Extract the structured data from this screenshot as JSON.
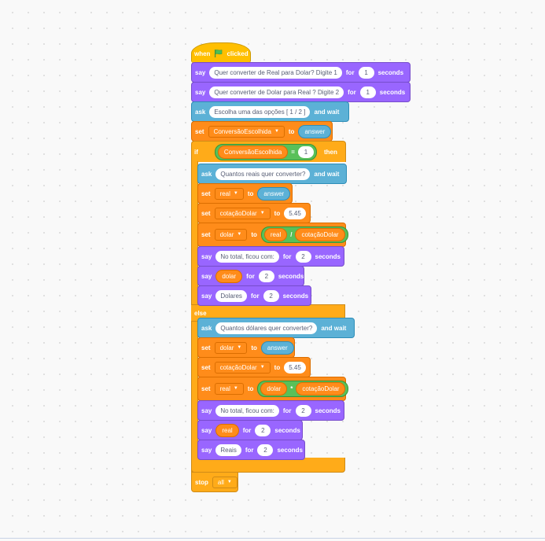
{
  "script": {
    "hat": {
      "when": "when",
      "clicked": "clicked",
      "flag_icon": "green-flag-icon"
    },
    "say1": {
      "kw": "say",
      "msg": "Quer converter de Real para Dolar? Digite 1",
      "for": "for",
      "secs": "1",
      "seconds": "seconds"
    },
    "say2": {
      "kw": "say",
      "msg": "Quer converter de Dolar para Real ? Digite 2",
      "for": "for",
      "secs": "1",
      "seconds": "seconds"
    },
    "ask1": {
      "kw": "ask",
      "question": "Escolha uma das opções [ 1 /  2 ]",
      "and_wait": "and wait"
    },
    "set1": {
      "kw": "set",
      "var": "ConversãoEscolhida",
      "to": "to",
      "value": "answer"
    },
    "if": {
      "kw": "if",
      "var": "ConversãoEscolhida",
      "op": "=",
      "value": "1",
      "then": "then",
      "else": "else"
    },
    "if_branch": {
      "ask": {
        "kw": "ask",
        "question": "Quantos reais quer converter?",
        "and_wait": "and wait"
      },
      "set_a": {
        "kw": "set",
        "var": "real",
        "to": "to",
        "value": "answer"
      },
      "set_b": {
        "kw": "set",
        "var": "cotaçãoDolar",
        "to": "to",
        "value": "5.45"
      },
      "set_c": {
        "kw": "set",
        "var": "dolar",
        "to": "to",
        "left": "real",
        "op": "/",
        "right": "cotaçãoDolar"
      },
      "say_a": {
        "kw": "say",
        "msg": "No total, ficou com:",
        "for": "for",
        "secs": "2",
        "seconds": "seconds"
      },
      "say_b": {
        "kw": "say",
        "msg": "dolar",
        "for": "for",
        "secs": "2",
        "seconds": "seconds"
      },
      "say_c": {
        "kw": "say",
        "msg": "Dolares",
        "for": "for",
        "secs": "2",
        "seconds": "seconds"
      }
    },
    "else_branch": {
      "ask": {
        "kw": "ask",
        "question": "Quantos dólares quer converter?",
        "and_wait": "and wait"
      },
      "set_a": {
        "kw": "set",
        "var": "dolar",
        "to": "to",
        "value": "answer"
      },
      "set_b": {
        "kw": "set",
        "var": "cotaçãoDolar",
        "to": "to",
        "value": "5.45"
      },
      "set_c": {
        "kw": "set",
        "var": "real",
        "to": "to",
        "left": "dolar",
        "op": "*",
        "right": "cotaçãoDolar"
      },
      "say_a": {
        "kw": "say",
        "msg": "No total, ficou com:",
        "for": "for",
        "secs": "2",
        "seconds": "seconds"
      },
      "say_b": {
        "kw": "say",
        "msg": "real",
        "for": "for",
        "secs": "2",
        "seconds": "seconds"
      },
      "say_c": {
        "kw": "say",
        "msg": "Reais",
        "for": "for",
        "secs": "2",
        "seconds": "seconds"
      }
    },
    "stop": {
      "kw": "stop",
      "option": "all"
    }
  },
  "colors": {
    "events": "#FFBF00",
    "control": "#FFAB19",
    "looks": "#9966FF",
    "sensing": "#5CB1D6",
    "variables": "#FF8C1A",
    "operators": "#59C059"
  }
}
